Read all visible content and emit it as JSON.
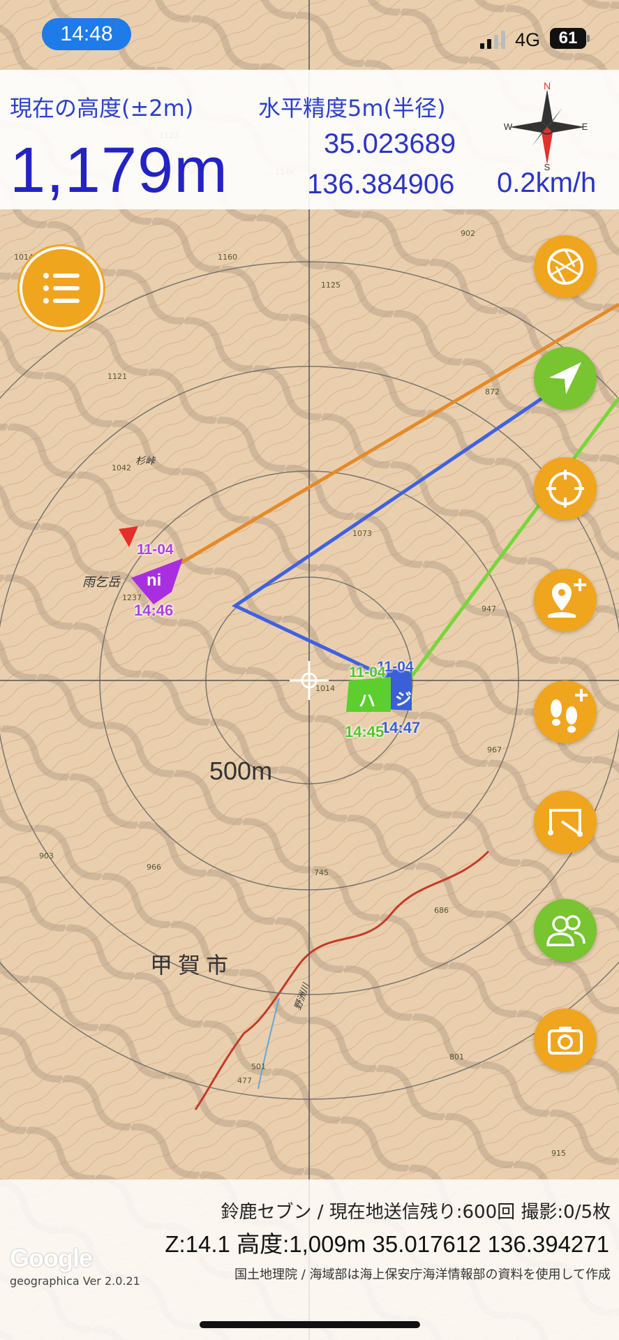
{
  "status_bar": {
    "time": "14:48",
    "network": "4G",
    "battery": "61"
  },
  "header": {
    "altitude_label": "現在の高度(±2m)",
    "accuracy_label": "水平精度5m(半径)",
    "altitude": "1,179m",
    "latitude": "35.023689",
    "longitude": "136.384906",
    "speed": "0.2km/h",
    "compass_letters": {
      "n": "N",
      "e": "E",
      "s": "S",
      "w": "W"
    }
  },
  "map": {
    "scale_label": "500m",
    "city_label": "甲賀市",
    "place_labels": {
      "mountain": "雨乞岳",
      "pass": "杉峠",
      "river": "野洲川"
    },
    "spot_heights": [
      "1160",
      "1125",
      "1123",
      "1146",
      "1121",
      "1042",
      "1237",
      "1073",
      "947",
      "1014",
      "967",
      "903",
      "966",
      "745",
      "686",
      "501",
      "801",
      "915",
      "902",
      "872",
      "1014",
      "477"
    ],
    "markers": [
      {
        "name": "ni",
        "date": "11-04",
        "time": "14:46",
        "color": "#b23ee0"
      },
      {
        "name": "ハ",
        "date": "11-04",
        "time": "14:45",
        "color": "#55c42a"
      },
      {
        "name": "ジ",
        "date": "11-04",
        "time": "14:47",
        "color": "#3a5fd6"
      }
    ],
    "track_colors": {
      "orange": "#e58a2a",
      "blue": "#3e62e0",
      "green": "#78d63a"
    }
  },
  "buttons": {
    "menu": "menu-icon",
    "side": [
      "aperture-icon",
      "navigation-arrow-icon",
      "crosshair-icon",
      "add-map-pin-icon",
      "add-footprints-icon",
      "route-icon",
      "group-icon",
      "camera-icon"
    ]
  },
  "footer": {
    "line1": "鈴鹿セブン / 現在地送信残り:600回 撮影:0/5枚",
    "line2": "Z:14.1 高度:1,009m 35.017612 136.394271",
    "attribution": "国土地理院 / 海域部は海上保安庁海洋情報部の資料を使用して作成",
    "google": "Google",
    "version": "geographica Ver 2.0.21"
  },
  "colors": {
    "accent_orange": "#f0a51e",
    "accent_green": "#78c431",
    "header_blue": "#2b3fc9"
  }
}
